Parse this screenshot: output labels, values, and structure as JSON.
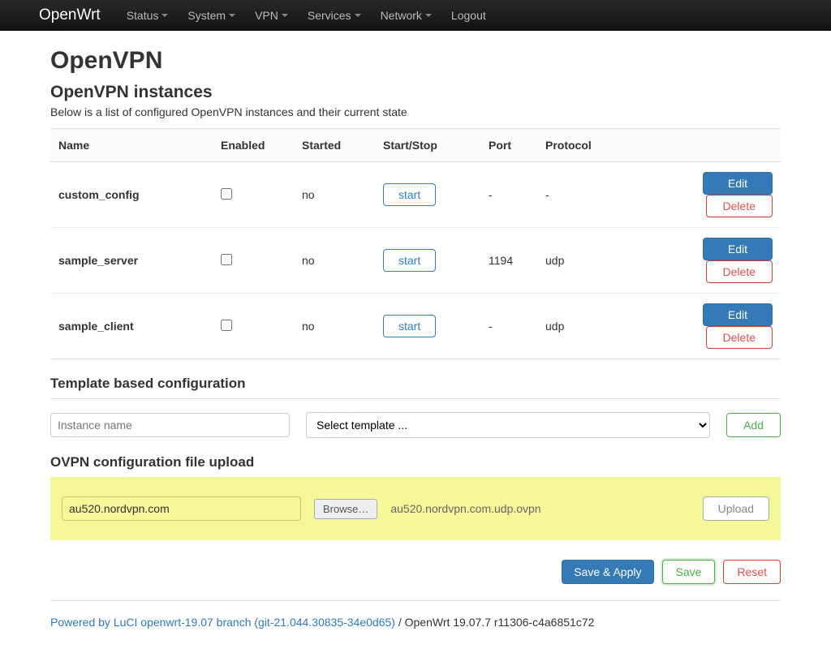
{
  "navbar": {
    "brand": "OpenWrt",
    "items": [
      "Status",
      "System",
      "VPN",
      "Services",
      "Network",
      "Logout"
    ]
  },
  "page": {
    "title": "OpenVPN",
    "section_title": "OpenVPN instances",
    "desc": "Below is a list of configured OpenVPN instances and their current state"
  },
  "table": {
    "headers": {
      "name": "Name",
      "enabled": "Enabled",
      "started": "Started",
      "startstop": "Start/Stop",
      "port": "Port",
      "protocol": "Protocol"
    },
    "rows": [
      {
        "name": "custom_config",
        "enabled": false,
        "started": "no",
        "ss": "start",
        "port": "-",
        "protocol": "-",
        "edit": "Edit",
        "delete": "Delete"
      },
      {
        "name": "sample_server",
        "enabled": false,
        "started": "no",
        "ss": "start",
        "port": "1194",
        "protocol": "udp",
        "edit": "Edit",
        "delete": "Delete"
      },
      {
        "name": "sample_client",
        "enabled": false,
        "started": "no",
        "ss": "start",
        "port": "-",
        "protocol": "udp",
        "edit": "Edit",
        "delete": "Delete"
      }
    ]
  },
  "template": {
    "title": "Template based configuration",
    "placeholder": "Instance name",
    "select_placeholder": "Select template ...",
    "add": "Add"
  },
  "upload": {
    "title": "OVPN configuration file upload",
    "input_value": "au520.nordvpn.com",
    "browse": "Browse…",
    "filename": "au520.nordvpn.com.udp.ovpn",
    "upload_btn": "Upload"
  },
  "actions": {
    "save_apply": "Save & Apply",
    "save": "Save",
    "reset": "Reset"
  },
  "footer": {
    "link": "Powered by LuCI openwrt-19.07 branch (git-21.044.30835-34e0d65)",
    "tail": " / OpenWrt 19.07.7 r11306-c4a6851c72"
  }
}
